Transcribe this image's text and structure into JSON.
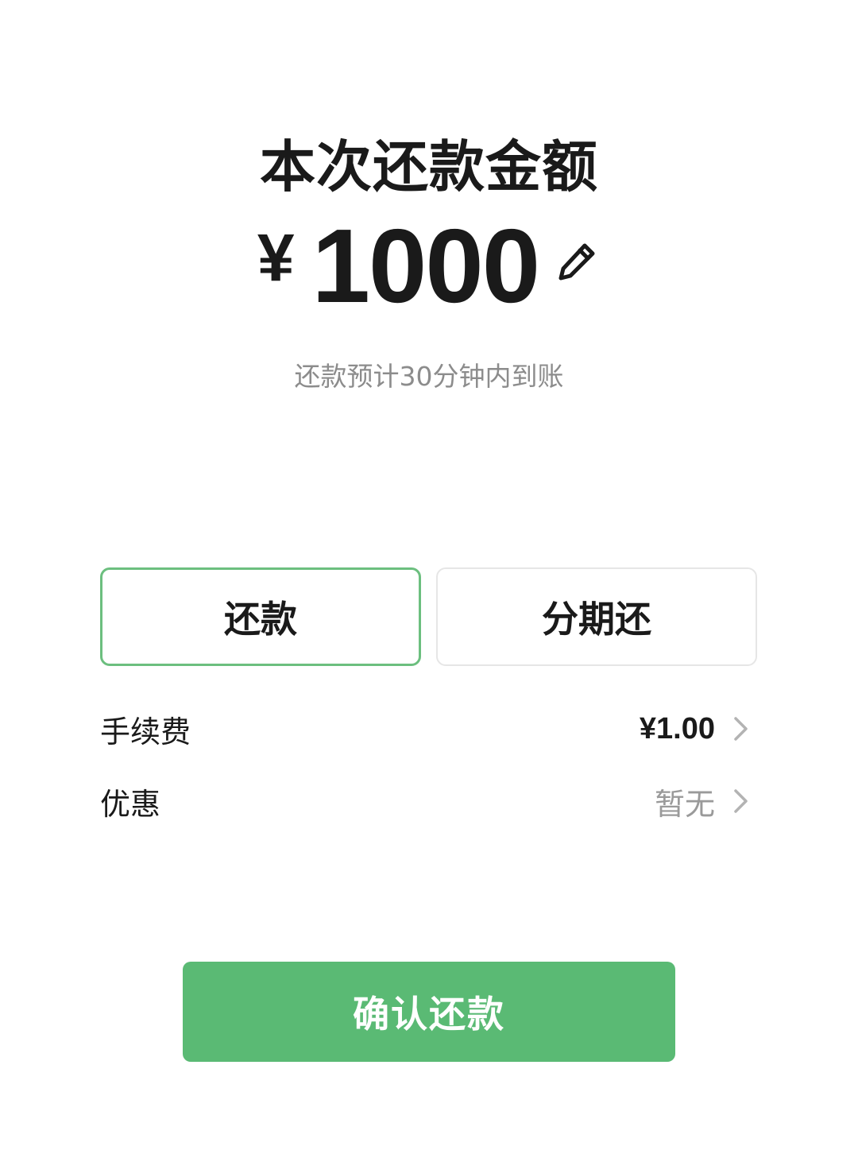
{
  "header": {
    "title": "本次还款金额"
  },
  "amount": {
    "currency": "¥",
    "value": "1000",
    "edit_icon": "pencil-icon"
  },
  "hint": "还款预计30分钟内到账",
  "modes": {
    "repay_label": "还款",
    "installment_label": "分期还",
    "selected": "还款"
  },
  "details": {
    "fee": {
      "label": "手续费",
      "value": "¥1.00",
      "icon": "chevron-right-icon"
    },
    "discount": {
      "label": "优惠",
      "value": "暂无",
      "icon": "chevron-right-icon"
    }
  },
  "confirm": {
    "label": "确认还款"
  },
  "colors": {
    "accent": "#5aba74",
    "selected_border": "#6cbf7f",
    "muted_text": "#8c8c8c"
  }
}
